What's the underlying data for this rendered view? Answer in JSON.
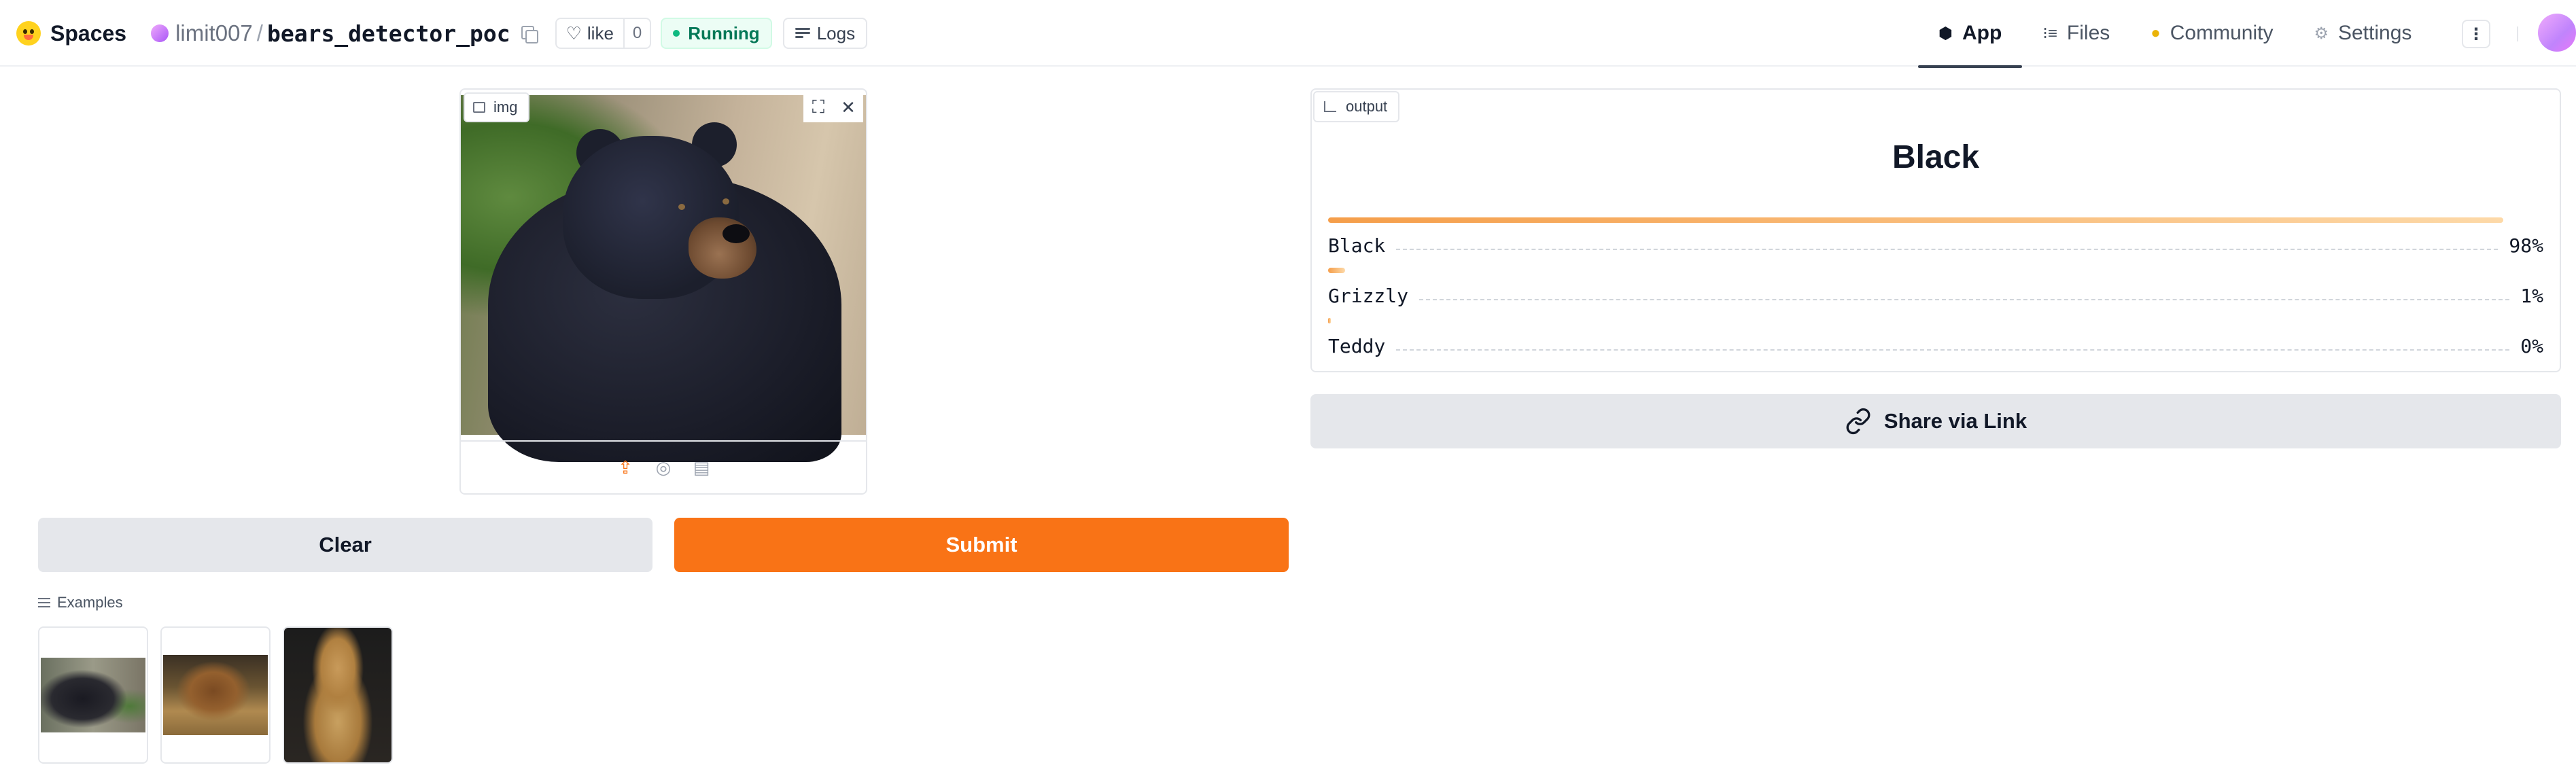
{
  "header": {
    "spaces_label": "Spaces",
    "owner": "limit007",
    "separator": "/",
    "repo": "bears_detector_poc",
    "like_label": "like",
    "like_count": "0",
    "status": "Running",
    "logs_label": "Logs",
    "nav": [
      {
        "label": "App",
        "icon": "cube-icon"
      },
      {
        "label": "Files",
        "icon": "files-icon"
      },
      {
        "label": "Community",
        "icon": "community-icon"
      },
      {
        "label": "Settings",
        "icon": "gear-icon"
      }
    ],
    "active_nav": "App"
  },
  "input": {
    "label": "img",
    "sources": [
      "upload-icon",
      "webcam-icon",
      "clipboard-icon"
    ]
  },
  "buttons": {
    "clear": "Clear",
    "submit": "Submit",
    "share": "Share via Link"
  },
  "examples": {
    "label": "Examples",
    "items": [
      "black bear",
      "grizzly bear",
      "teddy bear"
    ]
  },
  "output": {
    "label": "output",
    "title": "Black",
    "confidences": [
      {
        "label": "Black",
        "percent": "98%",
        "value": 0.98
      },
      {
        "label": "Grizzly",
        "percent": "1%",
        "value": 0.014
      },
      {
        "label": "Teddy",
        "percent": "0%",
        "value": 0.002
      }
    ]
  },
  "colors": {
    "accent": "#f97316",
    "running": "#10b981"
  }
}
